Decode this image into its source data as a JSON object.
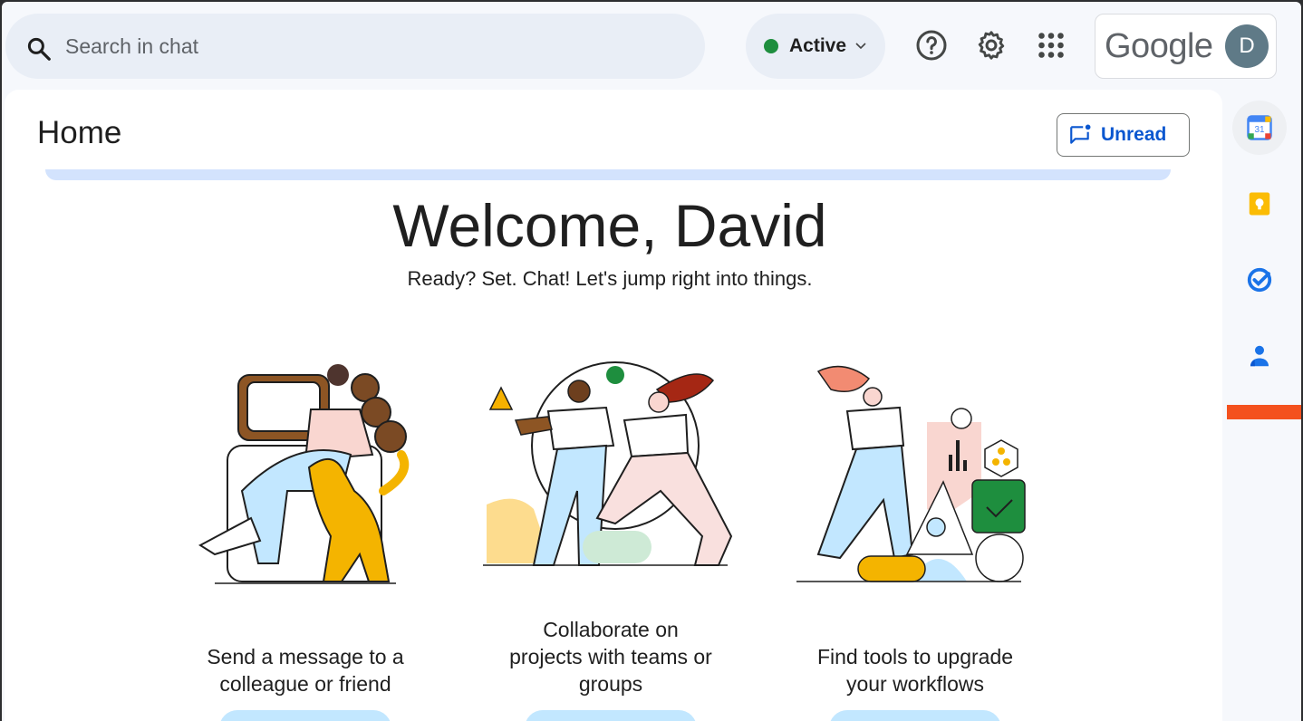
{
  "search": {
    "placeholder": "Search in chat"
  },
  "status": {
    "label": "Active",
    "color": "#1e8e3e"
  },
  "toolbar": {
    "help_icon": "help-circle-icon",
    "settings_icon": "gear-icon",
    "apps_icon": "apps-grid-icon"
  },
  "account": {
    "wordmark": "Google",
    "avatar_initial": "D"
  },
  "header": {
    "title": "Home",
    "unread_label": "Unread"
  },
  "welcome": {
    "title": "Welcome, David",
    "subtitle": "Ready? Set. Chat! Let's jump right into things."
  },
  "cards": [
    {
      "caption_lines": [
        "Send a message to a",
        "colleague or friend"
      ]
    },
    {
      "caption_lines": [
        "Collaborate on",
        "projects with teams or",
        "groups"
      ]
    },
    {
      "caption_lines": [
        "Find tools to upgrade",
        "your workflows"
      ]
    }
  ],
  "rail": {
    "items": [
      "calendar-icon",
      "keep-icon",
      "tasks-icon",
      "contacts-icon"
    ],
    "accent_color": "#f4511e"
  },
  "colors": {
    "accent": "#0b57d0",
    "surface": "#e9eef6",
    "pill": "#c2e7ff"
  }
}
